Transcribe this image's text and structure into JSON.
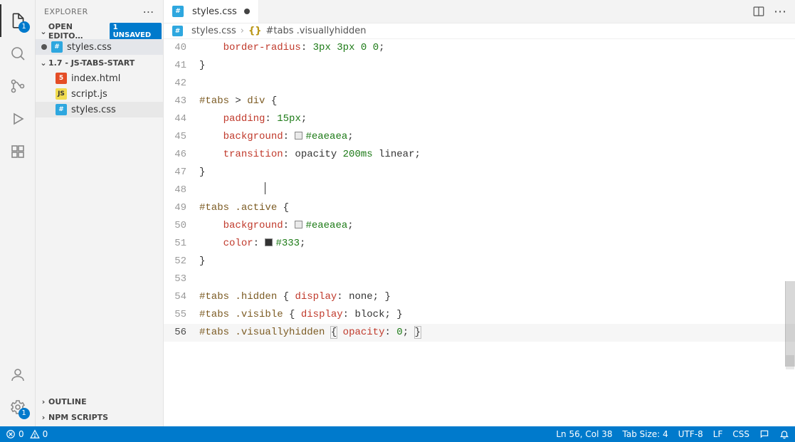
{
  "activity": {
    "files_badge": "1",
    "settings_badge": "1"
  },
  "sidebar": {
    "title": "EXPLORER",
    "open_editors": {
      "label": "OPEN EDITO…",
      "unsaved_badge": "1 UNSAVED",
      "items": [
        {
          "label": "styles.css",
          "type": "css",
          "modified": true
        }
      ]
    },
    "folder": {
      "label": "1.7 - JS-TABS-START",
      "items": [
        {
          "label": "index.html",
          "type": "html"
        },
        {
          "label": "script.js",
          "type": "js"
        },
        {
          "label": "styles.css",
          "type": "css",
          "selected": true
        }
      ]
    },
    "outline": "OUTLINE",
    "npm": "NPM SCRIPTS"
  },
  "tab": {
    "title": "styles.css"
  },
  "breadcrumbs": {
    "file": "styles.css",
    "symbol": "#tabs .visuallyhidden"
  },
  "code": {
    "lines": [
      {
        "n": 40,
        "html": "    <span class='tok-prop'>border-radius</span>: <span class='tok-num'>3px</span> <span class='tok-num'>3px</span> <span class='tok-num'>0</span> <span class='tok-num'>0</span>;"
      },
      {
        "n": 41,
        "html": "}"
      },
      {
        "n": 42,
        "html": ""
      },
      {
        "n": 43,
        "html": "<span class='tok-sel'>#tabs</span> <span class='tok-op'>&gt;</span> <span class='tok-class'>div</span> {"
      },
      {
        "n": 44,
        "html": "    <span class='tok-prop'>padding</span>: <span class='tok-num'>15px</span>;"
      },
      {
        "n": 45,
        "html": "    <span class='tok-prop'>background</span>: <span class='swatch' style='background:#eaeaea'></span><span class='tok-hex'>#eaeaea</span>;"
      },
      {
        "n": 46,
        "html": "    <span class='tok-prop'>transition</span>: opacity <span class='tok-num'>200ms</span> linear;"
      },
      {
        "n": 47,
        "html": "}"
      },
      {
        "n": 48,
        "html": "           <span class='cursor'></span>"
      },
      {
        "n": 49,
        "html": "<span class='tok-sel'>#tabs</span> <span class='tok-class'>.active</span> {"
      },
      {
        "n": 50,
        "html": "    <span class='tok-prop'>background</span>: <span class='swatch' style='background:#eaeaea'></span><span class='tok-hex'>#eaeaea</span>;"
      },
      {
        "n": 51,
        "html": "    <span class='tok-prop'>color</span>: <span class='swatch' style='background:#333'></span><span class='tok-hex'>#333</span>;"
      },
      {
        "n": 52,
        "html": "}"
      },
      {
        "n": 53,
        "html": ""
      },
      {
        "n": 54,
        "html": "<span class='tok-sel'>#tabs</span> <span class='tok-class'>.hidden</span> { <span class='tok-prop'>display</span>: none; }"
      },
      {
        "n": 55,
        "html": "<span class='tok-sel'>#tabs</span> <span class='tok-class'>.visible</span> { <span class='tok-prop'>display</span>: block; }"
      },
      {
        "n": 56,
        "html": "<span class='tok-sel'>#tabs</span> <span class='tok-class'>.visuallyhidden</span> <span class='matchbrace'>{</span> <span class='tok-prop'>opacity</span>: <span class='tok-num'>0</span>; <span class='matchbrace'>}</span>",
        "current": true
      }
    ]
  },
  "status": {
    "errors": "0",
    "warnings": "0",
    "position": "Ln 56, Col 38",
    "tabsize": "Tab Size: 4",
    "encoding": "UTF-8",
    "eol": "LF",
    "language": "CSS"
  }
}
